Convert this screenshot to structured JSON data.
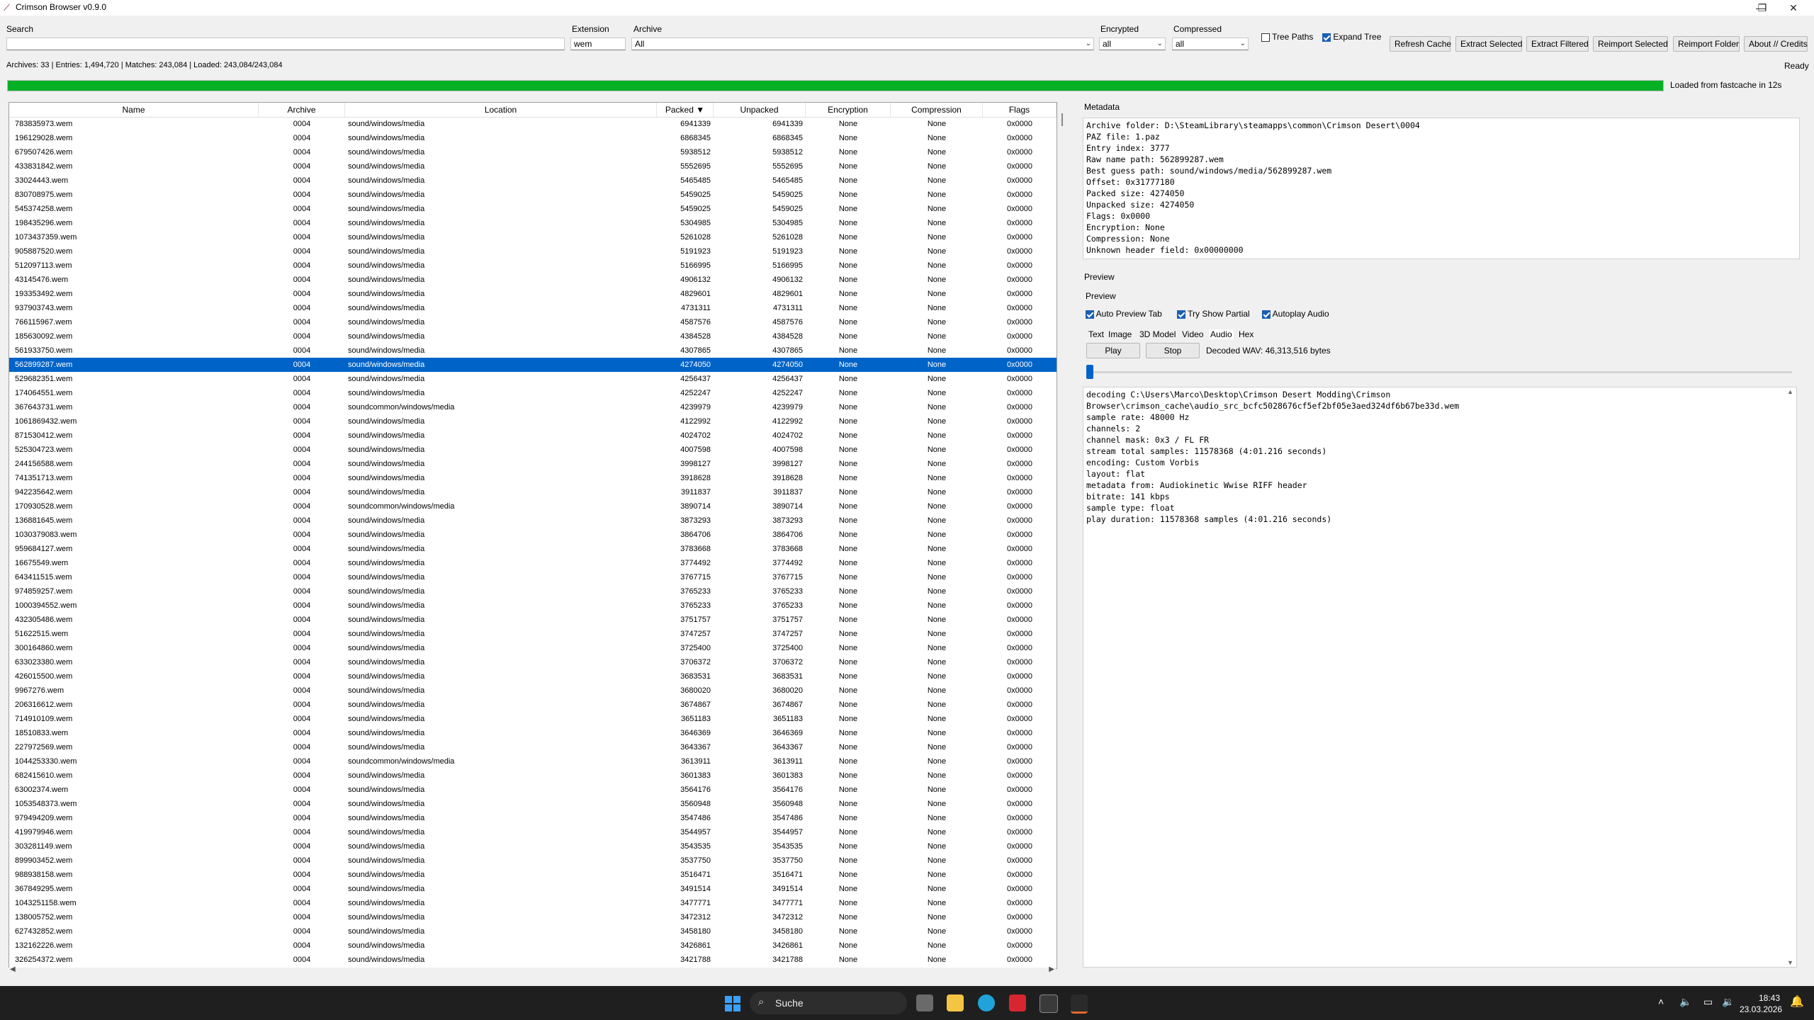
{
  "window": {
    "title": "Crimson Browser v0.9.0",
    "min": "—",
    "max": "❐",
    "close": "✕"
  },
  "toolbar": {
    "search_label": "Search",
    "search_value": "",
    "extension_label": "Extension",
    "extension_value": "wem",
    "archive_label": "Archive",
    "archive_value": "All",
    "encrypted_label": "Encrypted",
    "encrypted_value": "all",
    "compressed_label": "Compressed",
    "compressed_value": "all",
    "tree_paths_label": "Tree Paths",
    "tree_paths_checked": false,
    "expand_tree_label": "Expand Tree",
    "expand_tree_checked": true,
    "buttons": [
      "Refresh Cache",
      "Extract Selected",
      "Extract Filtered",
      "Reimport Selected",
      "Reimport Folder",
      "About // Credits"
    ]
  },
  "status": {
    "stats": "Archives: 33 | Entries: 1,494,720 | Matches: 243,084 | Loaded: 243,084/243,084",
    "ready": "Ready",
    "progress_text": "Loaded from fastcache in 12s",
    "progress_fraction": 1.0
  },
  "table": {
    "columns": [
      "Name",
      "Archive",
      "Location",
      "Packed ▼",
      "Unpacked",
      "Encryption",
      "Compression",
      "Flags"
    ],
    "selected_index": 17,
    "rows": [
      [
        "783835973.wem",
        "0004",
        "sound/windows/media",
        "6941339",
        "6941339",
        "None",
        "None",
        "0x0000"
      ],
      [
        "196129028.wem",
        "0004",
        "sound/windows/media",
        "6868345",
        "6868345",
        "None",
        "None",
        "0x0000"
      ],
      [
        "679507426.wem",
        "0004",
        "sound/windows/media",
        "5938512",
        "5938512",
        "None",
        "None",
        "0x0000"
      ],
      [
        "433831842.wem",
        "0004",
        "sound/windows/media",
        "5552695",
        "5552695",
        "None",
        "None",
        "0x0000"
      ],
      [
        "33024443.wem",
        "0004",
        "sound/windows/media",
        "5465485",
        "5465485",
        "None",
        "None",
        "0x0000"
      ],
      [
        "830708975.wem",
        "0004",
        "sound/windows/media",
        "5459025",
        "5459025",
        "None",
        "None",
        "0x0000"
      ],
      [
        "545374258.wem",
        "0004",
        "sound/windows/media",
        "5459025",
        "5459025",
        "None",
        "None",
        "0x0000"
      ],
      [
        "198435296.wem",
        "0004",
        "sound/windows/media",
        "5304985",
        "5304985",
        "None",
        "None",
        "0x0000"
      ],
      [
        "1073437359.wem",
        "0004",
        "sound/windows/media",
        "5261028",
        "5261028",
        "None",
        "None",
        "0x0000"
      ],
      [
        "905887520.wem",
        "0004",
        "sound/windows/media",
        "5191923",
        "5191923",
        "None",
        "None",
        "0x0000"
      ],
      [
        "512097113.wem",
        "0004",
        "sound/windows/media",
        "5166995",
        "5166995",
        "None",
        "None",
        "0x0000"
      ],
      [
        "43145476.wem",
        "0004",
        "sound/windows/media",
        "4906132",
        "4906132",
        "None",
        "None",
        "0x0000"
      ],
      [
        "193353492.wem",
        "0004",
        "sound/windows/media",
        "4829601",
        "4829601",
        "None",
        "None",
        "0x0000"
      ],
      [
        "937903743.wem",
        "0004",
        "sound/windows/media",
        "4731311",
        "4731311",
        "None",
        "None",
        "0x0000"
      ],
      [
        "766115967.wem",
        "0004",
        "sound/windows/media",
        "4587576",
        "4587576",
        "None",
        "None",
        "0x0000"
      ],
      [
        "185630092.wem",
        "0004",
        "sound/windows/media",
        "4384528",
        "4384528",
        "None",
        "None",
        "0x0000"
      ],
      [
        "561933750.wem",
        "0004",
        "sound/windows/media",
        "4307865",
        "4307865",
        "None",
        "None",
        "0x0000"
      ],
      [
        "562899287.wem",
        "0004",
        "sound/windows/media",
        "4274050",
        "4274050",
        "None",
        "None",
        "0x0000"
      ],
      [
        "529682351.wem",
        "0004",
        "sound/windows/media",
        "4256437",
        "4256437",
        "None",
        "None",
        "0x0000"
      ],
      [
        "174064551.wem",
        "0004",
        "sound/windows/media",
        "4252247",
        "4252247",
        "None",
        "None",
        "0x0000"
      ],
      [
        "367643731.wem",
        "0004",
        "soundcommon/windows/media",
        "4239979",
        "4239979",
        "None",
        "None",
        "0x0000"
      ],
      [
        "1061869432.wem",
        "0004",
        "sound/windows/media",
        "4122992",
        "4122992",
        "None",
        "None",
        "0x0000"
      ],
      [
        "871530412.wem",
        "0004",
        "sound/windows/media",
        "4024702",
        "4024702",
        "None",
        "None",
        "0x0000"
      ],
      [
        "525304723.wem",
        "0004",
        "sound/windows/media",
        "4007598",
        "4007598",
        "None",
        "None",
        "0x0000"
      ],
      [
        "244156588.wem",
        "0004",
        "sound/windows/media",
        "3998127",
        "3998127",
        "None",
        "None",
        "0x0000"
      ],
      [
        "741351713.wem",
        "0004",
        "sound/windows/media",
        "3918628",
        "3918628",
        "None",
        "None",
        "0x0000"
      ],
      [
        "942235642.wem",
        "0004",
        "sound/windows/media",
        "3911837",
        "3911837",
        "None",
        "None",
        "0x0000"
      ],
      [
        "170930528.wem",
        "0004",
        "soundcommon/windows/media",
        "3890714",
        "3890714",
        "None",
        "None",
        "0x0000"
      ],
      [
        "136881645.wem",
        "0004",
        "sound/windows/media",
        "3873293",
        "3873293",
        "None",
        "None",
        "0x0000"
      ],
      [
        "1030379083.wem",
        "0004",
        "sound/windows/media",
        "3864706",
        "3864706",
        "None",
        "None",
        "0x0000"
      ],
      [
        "959684127.wem",
        "0004",
        "sound/windows/media",
        "3783668",
        "3783668",
        "None",
        "None",
        "0x0000"
      ],
      [
        "16675549.wem",
        "0004",
        "sound/windows/media",
        "3774492",
        "3774492",
        "None",
        "None",
        "0x0000"
      ],
      [
        "643411515.wem",
        "0004",
        "sound/windows/media",
        "3767715",
        "3767715",
        "None",
        "None",
        "0x0000"
      ],
      [
        "974859257.wem",
        "0004",
        "sound/windows/media",
        "3765233",
        "3765233",
        "None",
        "None",
        "0x0000"
      ],
      [
        "1000394552.wem",
        "0004",
        "sound/windows/media",
        "3765233",
        "3765233",
        "None",
        "None",
        "0x0000"
      ],
      [
        "432305486.wem",
        "0004",
        "sound/windows/media",
        "3751757",
        "3751757",
        "None",
        "None",
        "0x0000"
      ],
      [
        "51622515.wem",
        "0004",
        "sound/windows/media",
        "3747257",
        "3747257",
        "None",
        "None",
        "0x0000"
      ],
      [
        "300164860.wem",
        "0004",
        "sound/windows/media",
        "3725400",
        "3725400",
        "None",
        "None",
        "0x0000"
      ],
      [
        "633023380.wem",
        "0004",
        "sound/windows/media",
        "3706372",
        "3706372",
        "None",
        "None",
        "0x0000"
      ],
      [
        "426015500.wem",
        "0004",
        "sound/windows/media",
        "3683531",
        "3683531",
        "None",
        "None",
        "0x0000"
      ],
      [
        "9967276.wem",
        "0004",
        "sound/windows/media",
        "3680020",
        "3680020",
        "None",
        "None",
        "0x0000"
      ],
      [
        "206316612.wem",
        "0004",
        "sound/windows/media",
        "3674867",
        "3674867",
        "None",
        "None",
        "0x0000"
      ],
      [
        "714910109.wem",
        "0004",
        "sound/windows/media",
        "3651183",
        "3651183",
        "None",
        "None",
        "0x0000"
      ],
      [
        "18510833.wem",
        "0004",
        "sound/windows/media",
        "3646369",
        "3646369",
        "None",
        "None",
        "0x0000"
      ],
      [
        "227972569.wem",
        "0004",
        "sound/windows/media",
        "3643367",
        "3643367",
        "None",
        "None",
        "0x0000"
      ],
      [
        "1044253330.wem",
        "0004",
        "soundcommon/windows/media",
        "3613911",
        "3613911",
        "None",
        "None",
        "0x0000"
      ],
      [
        "682415610.wem",
        "0004",
        "sound/windows/media",
        "3601383",
        "3601383",
        "None",
        "None",
        "0x0000"
      ],
      [
        "63002374.wem",
        "0004",
        "sound/windows/media",
        "3564176",
        "3564176",
        "None",
        "None",
        "0x0000"
      ],
      [
        "1053548373.wem",
        "0004",
        "sound/windows/media",
        "3560948",
        "3560948",
        "None",
        "None",
        "0x0000"
      ],
      [
        "979494209.wem",
        "0004",
        "sound/windows/media",
        "3547486",
        "3547486",
        "None",
        "None",
        "0x0000"
      ],
      [
        "419979946.wem",
        "0004",
        "sound/windows/media",
        "3544957",
        "3544957",
        "None",
        "None",
        "0x0000"
      ],
      [
        "303281149.wem",
        "0004",
        "sound/windows/media",
        "3543535",
        "3543535",
        "None",
        "None",
        "0x0000"
      ],
      [
        "899903452.wem",
        "0004",
        "sound/windows/media",
        "3537750",
        "3537750",
        "None",
        "None",
        "0x0000"
      ],
      [
        "988938158.wem",
        "0004",
        "sound/windows/media",
        "3516471",
        "3516471",
        "None",
        "None",
        "0x0000"
      ],
      [
        "367849295.wem",
        "0004",
        "sound/windows/media",
        "3491514",
        "3491514",
        "None",
        "None",
        "0x0000"
      ],
      [
        "1043251158.wem",
        "0004",
        "sound/windows/media",
        "3477771",
        "3477771",
        "None",
        "None",
        "0x0000"
      ],
      [
        "138005752.wem",
        "0004",
        "sound/windows/media",
        "3472312",
        "3472312",
        "None",
        "None",
        "0x0000"
      ],
      [
        "627432852.wem",
        "0004",
        "sound/windows/media",
        "3458180",
        "3458180",
        "None",
        "None",
        "0x0000"
      ],
      [
        "132162226.wem",
        "0004",
        "sound/windows/media",
        "3426861",
        "3426861",
        "None",
        "None",
        "0x0000"
      ],
      [
        "326254372.wem",
        "0004",
        "sound/windows/media",
        "3421788",
        "3421788",
        "None",
        "None",
        "0x0000"
      ]
    ]
  },
  "metadata": {
    "title": "Metadata",
    "lines": [
      "Archive folder: D:\\SteamLibrary\\steamapps\\common\\Crimson Desert\\0004",
      "PAZ file: 1.paz",
      "Entry index: 3777",
      "Raw name path: 562899287.wem",
      "Best guess path: sound/windows/media/562899287.wem",
      "Offset: 0x31777180",
      "Packed size: 4274050",
      "Unpacked size: 4274050",
      "Flags: 0x0000",
      "Encryption: None",
      "Compression: None",
      "Unknown header field: 0x00000000"
    ]
  },
  "preview": {
    "group_title": "Preview",
    "inner_title": "Preview",
    "auto_preview_tab": "Auto Preview Tab",
    "try_show_partial": "Try Show Partial",
    "autoplay_audio": "Autoplay Audio",
    "tabs": [
      "Text",
      "Image",
      "3D Model",
      "Video",
      "Audio",
      "Hex"
    ],
    "active_tab": "Audio",
    "play_label": "Play",
    "stop_label": "Stop",
    "decoded_text": "Decoded WAV: 46,313,516 bytes",
    "slider_position": 0.0,
    "log_lines": [
      "decoding C:\\Users\\Marco\\Desktop\\Crimson Desert Modding\\Crimson",
      "Browser\\crimson_cache\\audio_src_bcfc5028676cf5ef2bf05e3aed324df6b67be33d.wem",
      "sample rate: 48000 Hz",
      "channels: 2",
      "channel mask: 0x3 / FL FR",
      "stream total samples: 11578368 (4:01.216 seconds)",
      "encoding: Custom Vorbis",
      "layout: flat",
      "metadata from: Audiokinetic Wwise RIFF header",
      "bitrate: 141 kbps",
      "sample type: float",
      "play duration: 11578368 samples (4:01.216 seconds)"
    ]
  },
  "taskbar": {
    "search_label": "Suche",
    "time": "18:43",
    "date": "23.03.2026"
  }
}
